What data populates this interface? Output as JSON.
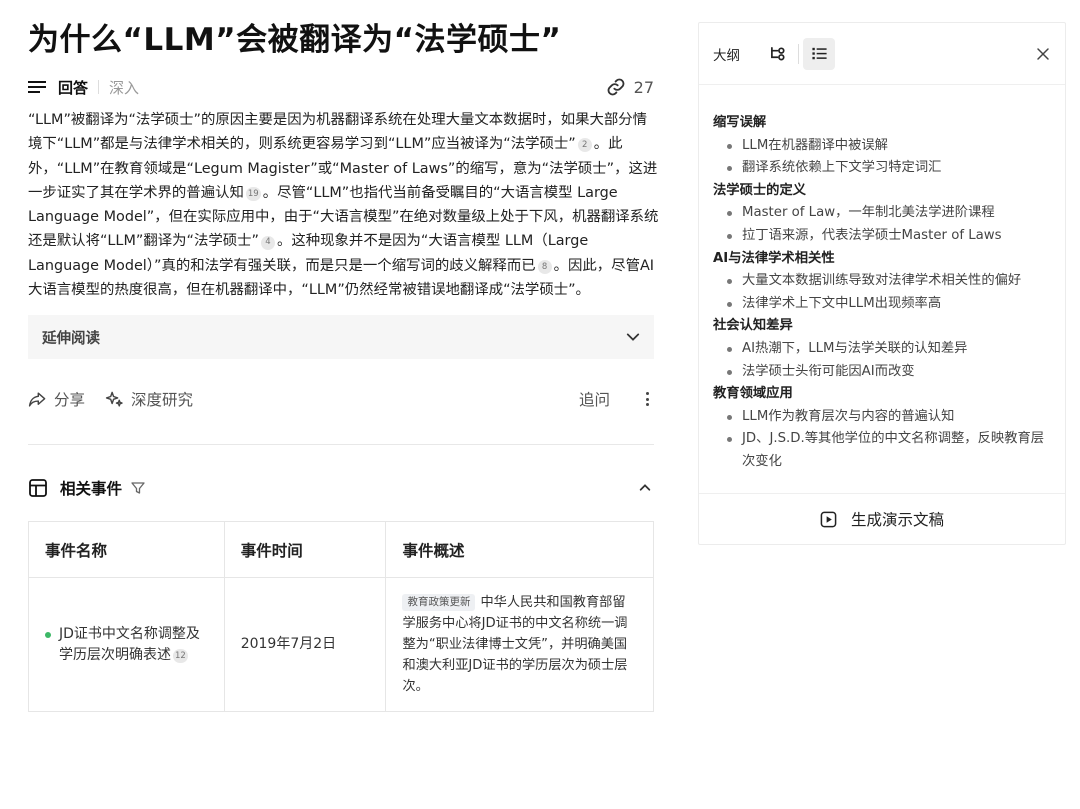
{
  "question": {
    "title": "为什么“LLM”会被翻译为“法学硕士”"
  },
  "tabs": {
    "answer": "回答",
    "deep": "深入",
    "ref_count": "27"
  },
  "answer": {
    "p1": "“LLM”被翻译为“法学硕士”的原因主要是因为机器翻译系统在处理大量文本数据时，如果大部分情境下“LLM”都是与法律学术相关的，则系统更容易学习到“LLM”应当被译为“法学硕士”",
    "c1": "2",
    "p2": "。此外，“LLM”在教育领域是“Legum Magister”或“Master of Laws”的缩写，意为“法学硕士”，这进一步证实了其在学术界的普遍认知",
    "c2": "19",
    "p3": "。尽管“LLM”也指代当前备受瞩目的“大语言模型 Large Language Model”，但在实际应用中，由于“大语言模型”在绝对数量级上处于下风，机器翻译系统还是默认将“LLM”翻译为“法学硕士”",
    "c3": "4",
    "p4": "。这种现象并不是因为“大语言模型 LLM（Large Language Model）”真的和法学有强关联，而是只是一个缩写词的歧义解释而已",
    "c4": "8",
    "p5": "。因此，尽管AI大语言模型的热度很高，但在机器翻译中，“LLM”仍然经常被错误地翻译成“法学硕士”。"
  },
  "further_reading": "延伸阅读",
  "actions": {
    "share": "分享",
    "research": "深度研究",
    "followup": "追问"
  },
  "events": {
    "title": "相关事件",
    "columns": [
      "事件名称",
      "事件时间",
      "事件概述"
    ],
    "rows": [
      {
        "name": "JD证书中文名称调整及学历层次明确表述",
        "cite": "12",
        "time": "2019年7月2日",
        "tag": "教育政策更新",
        "desc": "中华人民共和国教育部留学服务中心将JD证书的中文名称统一调整为“职业法律博士文凭”，并明确美国和澳大利亚JD证书的学历层次为硕士层次。"
      }
    ]
  },
  "sidebar": {
    "title": "大纲",
    "sections": [
      {
        "heading": "缩写误解",
        "items": [
          "LLM在机器翻译中被误解",
          "翻译系统依赖上下文学习特定词汇"
        ]
      },
      {
        "heading": "法学硕士的定义",
        "items": [
          "Master of Law，一年制北美法学进阶课程",
          "拉丁语来源，代表法学硕士Master of Laws"
        ]
      },
      {
        "heading": "AI与法律学术相关性",
        "items": [
          "大量文本数据训练导致对法律学术相关性的偏好",
          "法律学术上下文中LLM出现频率高"
        ]
      },
      {
        "heading": "社会认知差异",
        "items": [
          "AI热潮下，LLM与法学关联的认知差异",
          "法学硕士头衔可能因AI而改变"
        ]
      },
      {
        "heading": "教育领域应用",
        "items": [
          "LLM作为教育层次与内容的普遍认知",
          "JD、J.S.D.等其他学位的中文名称调整，反映教育层次变化"
        ]
      }
    ],
    "generate_button": "生成演示文稿"
  }
}
